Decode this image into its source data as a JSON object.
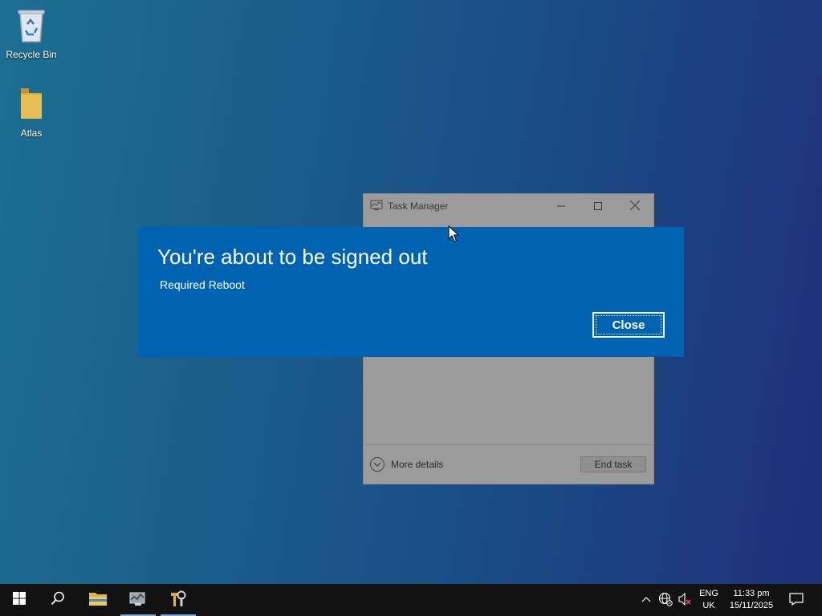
{
  "desktop": {
    "icons": [
      {
        "label": "Recycle Bin",
        "icon": "recycle-bin-icon"
      },
      {
        "label": "Atlas",
        "icon": "folder-icon"
      }
    ]
  },
  "task_manager": {
    "title": "Task Manager",
    "more_details_label": "More details",
    "end_task_label": "End task"
  },
  "signout_dialog": {
    "heading": "You're about to be signed out",
    "message": "Required Reboot",
    "close_label": "Close",
    "background_color": "#0063b1"
  },
  "taskbar": {
    "apps": [
      {
        "icon": "windows-start-icon"
      },
      {
        "icon": "search-icon"
      },
      {
        "icon": "file-explorer-icon"
      },
      {
        "icon": "task-manager-icon"
      },
      {
        "icon": "atlas-toolbox-icon"
      }
    ],
    "tray": {
      "language_line1": "ENG",
      "language_line2": "UK",
      "time": "11:33 pm",
      "date": "15/11/2025"
    }
  }
}
